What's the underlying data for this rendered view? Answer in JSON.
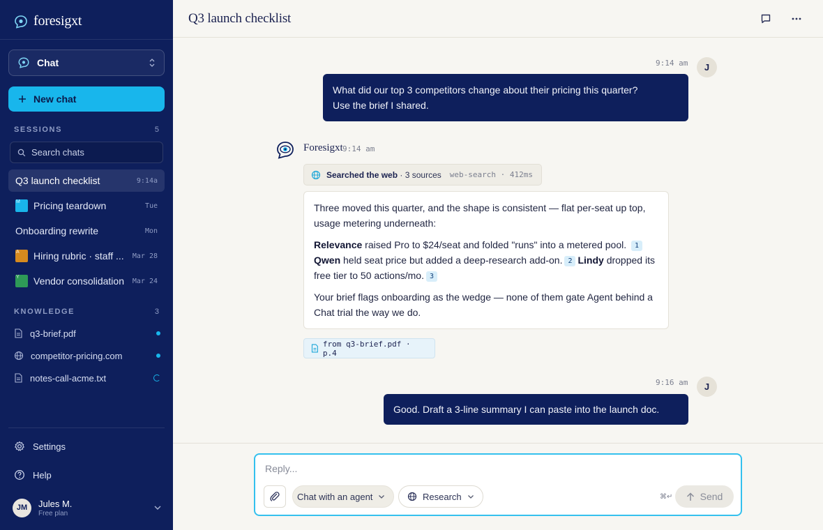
{
  "app": {
    "brand": "foresigxt",
    "agent_name": "Foresigxt"
  },
  "sidebar": {
    "mode_label": "Chat",
    "new_chat_label": "New chat",
    "sessions_heading": "SESSIONS",
    "sessions_count": "5",
    "search_placeholder": "Search chats",
    "sessions": [
      {
        "title": "Q3 launch checklist",
        "time": "9:14a",
        "active": true
      },
      {
        "title": "Pricing teardown",
        "time": "Tue",
        "thumb_color": "#19b5ea"
      },
      {
        "title": "Onboarding rewrite",
        "time": "Mon"
      },
      {
        "title": "Hiring rubric · staff ...",
        "time": "Mar 28",
        "thumb_color": "#d68a1f"
      },
      {
        "title": "Vendor consolidation",
        "time": "Mar 24",
        "thumb_color": "#2e9a57"
      }
    ],
    "knowledge_heading": "KNOWLEDGE",
    "knowledge_count": "3",
    "knowledge": [
      {
        "name": "q3-brief.pdf",
        "icon": "file-icon",
        "status": "indexed"
      },
      {
        "name": "competitor-pricing.com",
        "icon": "globe-icon",
        "status": "indexed"
      },
      {
        "name": "notes-call-acme.txt",
        "icon": "file-icon",
        "status": "loading"
      }
    ],
    "settings_label": "Settings",
    "help_label": "Help",
    "user": {
      "initials": "JM",
      "name": "Jules M.",
      "plan": "Free plan"
    }
  },
  "header": {
    "title": "Q3 launch checklist"
  },
  "conversation": {
    "msg1": {
      "time": "9:14 am",
      "avatar": "J",
      "line1": "What did our top 3 competitors change about their pricing this quarter?",
      "line2": "Use the brief I shared."
    },
    "reply": {
      "time": "9:14 am",
      "tool": {
        "label": "Searched the web",
        "sources": "· 3 sources",
        "meta": "web-search · 412ms"
      },
      "p1": "Three moved this quarter, and the shape is consistent — flat per-seat up top, usage metering underneath:",
      "p2": {
        "c1_name": "Relevance",
        "c1_text": " raised Pro to $24/seat and folded \"runs\" into a metered pool.",
        "cite1": "1",
        "c2_name": "Qwen",
        "c2_text": " held seat price but added a deep-research add-on.",
        "cite2": "2",
        "c3_name": "Lindy",
        "c3_text": " dropped its free tier to 50 actions/mo.",
        "cite3": "3"
      },
      "p3": "Your brief flags onboarding as the wedge — none of them gate Agent behind a Chat trial the way we do.",
      "source": "from q3-brief.pdf · p.4"
    },
    "msg2": {
      "time": "9:16 am",
      "avatar": "J",
      "text": "Good. Draft a 3-line summary I can paste into the launch doc."
    }
  },
  "composer": {
    "placeholder": "Reply...",
    "mode_label": "Chat with an agent",
    "research_label": "Research",
    "shortcut": "⌘↵",
    "send_label": "Send"
  },
  "colors": {
    "sidebar_bg": "#0e1f5c",
    "accent": "#18b6ec",
    "user_bubble": "#0e1f5c"
  }
}
